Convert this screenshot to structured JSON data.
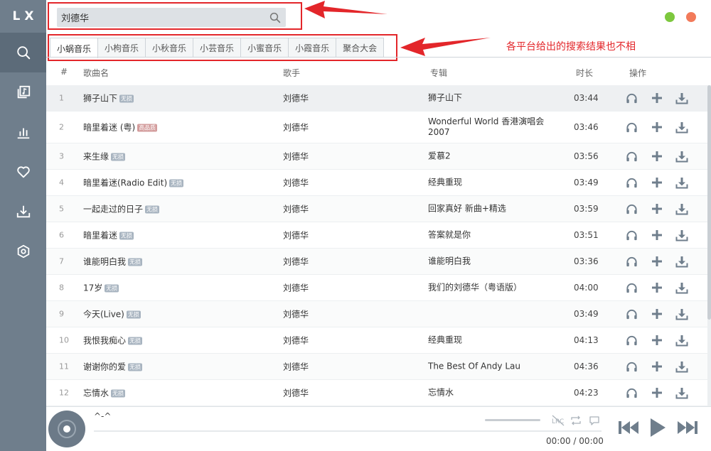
{
  "app": {
    "logo": "LX"
  },
  "sidebar": {
    "items": [
      {
        "name": "search",
        "icon": "search-icon",
        "active": true
      },
      {
        "name": "song-list",
        "icon": "music-note-icon",
        "active": false
      },
      {
        "name": "leaderboard",
        "icon": "chart-icon",
        "active": false
      },
      {
        "name": "favorites",
        "icon": "heart-icon",
        "active": false
      },
      {
        "name": "download",
        "icon": "download-icon",
        "active": false
      },
      {
        "name": "settings",
        "icon": "hexagon-icon",
        "active": false
      }
    ]
  },
  "search": {
    "value": "刘德华"
  },
  "annotation": {
    "text": "各平台给出的搜索结果也不相"
  },
  "tabs": [
    {
      "label": "小蜗音乐",
      "active": true
    },
    {
      "label": "小枸音乐",
      "active": false
    },
    {
      "label": "小秋音乐",
      "active": false
    },
    {
      "label": "小芸音乐",
      "active": false
    },
    {
      "label": "小蜜音乐",
      "active": false
    },
    {
      "label": "小霞音乐",
      "active": false
    },
    {
      "label": "聚合大会",
      "active": false
    }
  ],
  "table": {
    "headers": {
      "num": "#",
      "name": "歌曲名",
      "singer": "歌手",
      "album": "专辑",
      "duration": "时长",
      "actions": "操作"
    },
    "rows": [
      {
        "num": "1",
        "name": "狮子山下",
        "badge": "无损",
        "badge_type": "lossless",
        "singer": "刘德华",
        "album": "狮子山下",
        "duration": "03:44"
      },
      {
        "num": "2",
        "name": "暗里着迷 (粤)",
        "badge": "高品质",
        "badge_type": "hq",
        "singer": "刘德华",
        "album": "Wonderful World 香港演唱会 2007",
        "duration": "03:46",
        "tall": true
      },
      {
        "num": "3",
        "name": "来生缘",
        "badge": "无损",
        "badge_type": "lossless",
        "singer": "刘德华",
        "album": "爱慕2",
        "duration": "03:56"
      },
      {
        "num": "4",
        "name": "暗里着迷(Radio Edit)",
        "badge": "无损",
        "badge_type": "lossless",
        "singer": "刘德华",
        "album": "经典重现",
        "duration": "03:49"
      },
      {
        "num": "5",
        "name": "一起走过的日子",
        "badge": "无损",
        "badge_type": "lossless",
        "singer": "刘德华",
        "album": "回家真好 新曲+精选",
        "duration": "03:59"
      },
      {
        "num": "6",
        "name": "暗里着迷",
        "badge": "无损",
        "badge_type": "lossless",
        "singer": "刘德华",
        "album": "答案就是你",
        "duration": "03:51"
      },
      {
        "num": "7",
        "name": "谁能明白我",
        "badge": "无损",
        "badge_type": "lossless",
        "singer": "刘德华",
        "album": "谁能明白我",
        "duration": "03:36"
      },
      {
        "num": "8",
        "name": "17岁",
        "badge": "无损",
        "badge_type": "lossless",
        "singer": "刘德华",
        "album": "我们的刘德华（粤语版）",
        "duration": "04:00"
      },
      {
        "num": "9",
        "name": "今天(Live)",
        "badge": "无损",
        "badge_type": "lossless",
        "singer": "刘德华",
        "album": "",
        "duration": "03:49"
      },
      {
        "num": "10",
        "name": "我恨我痴心",
        "badge": "无损",
        "badge_type": "lossless",
        "singer": "刘德华",
        "album": "经典重现",
        "duration": "04:13"
      },
      {
        "num": "11",
        "name": "谢谢你的爱",
        "badge": "无损",
        "badge_type": "lossless",
        "singer": "刘德华",
        "album": "The Best Of Andy Lau",
        "duration": "04:36"
      },
      {
        "num": "12",
        "name": "忘情水",
        "badge": "无损",
        "badge_type": "lossless",
        "singer": "刘德华",
        "album": "忘情水",
        "duration": "04:23"
      }
    ]
  },
  "player": {
    "title": "^-^",
    "time_current": "00:00",
    "time_separator": "/",
    "time_total": "00:00",
    "progress_fraction": 0
  }
}
